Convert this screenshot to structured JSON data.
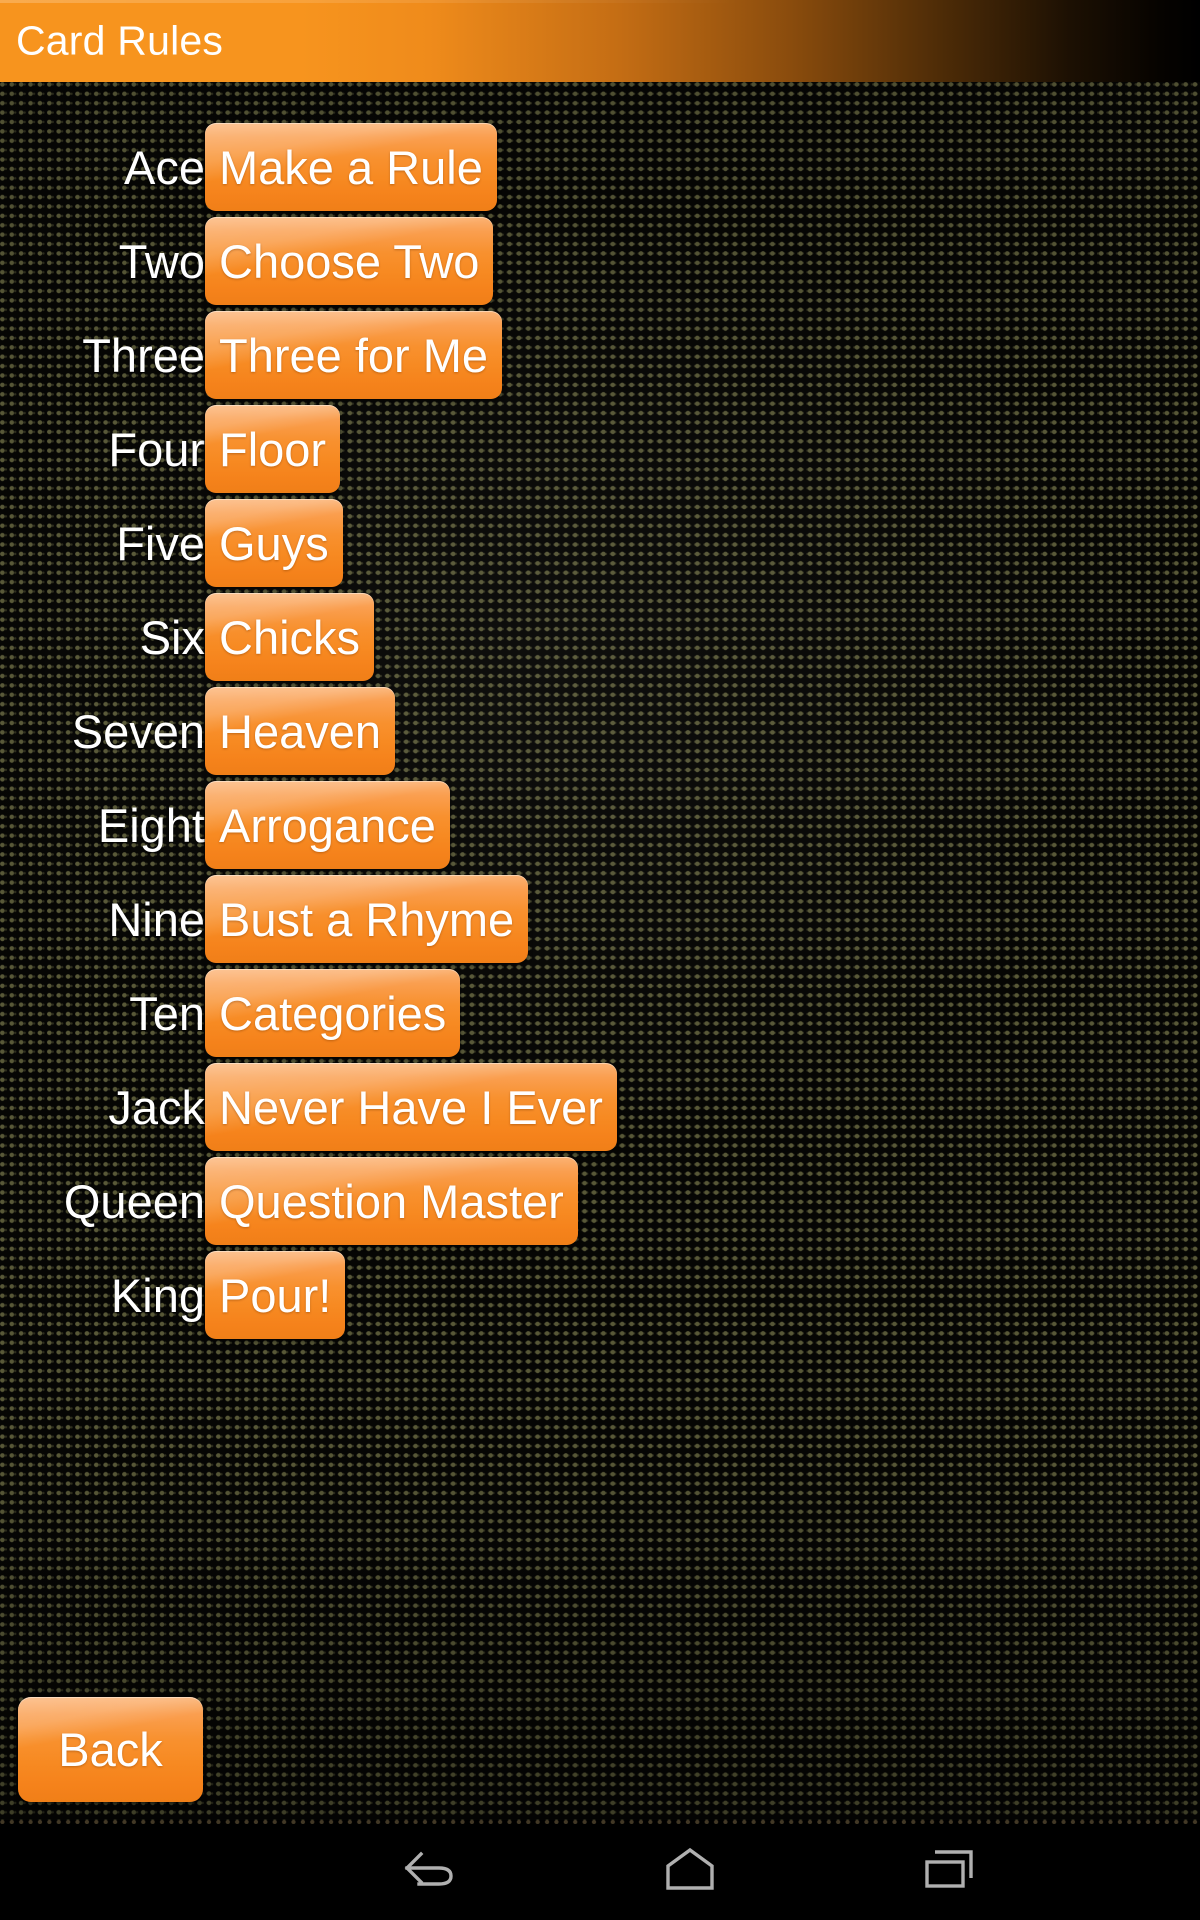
{
  "app": {
    "title": "Card Rules"
  },
  "rules": {
    "rows": [
      {
        "card": "Ace",
        "rule": "Make a Rule"
      },
      {
        "card": "Two",
        "rule": "Choose Two"
      },
      {
        "card": "Three",
        "rule": "Three for Me"
      },
      {
        "card": "Four",
        "rule": "Floor"
      },
      {
        "card": "Five",
        "rule": "Guys"
      },
      {
        "card": "Six",
        "rule": "Chicks"
      },
      {
        "card": "Seven",
        "rule": "Heaven"
      },
      {
        "card": "Eight",
        "rule": "Arrogance"
      },
      {
        "card": "Nine",
        "rule": "Bust a Rhyme"
      },
      {
        "card": "Ten",
        "rule": "Categories"
      },
      {
        "card": "Jack",
        "rule": "Never Have I Ever"
      },
      {
        "card": "Queen",
        "rule": "Question Master"
      },
      {
        "card": "King",
        "rule": "Pour!"
      }
    ]
  },
  "footer": {
    "back_label": "Back"
  },
  "navbar": {
    "back_icon": "back-arrow-icon",
    "home_icon": "home-pentagon-icon",
    "recents_icon": "recent-apps-icon"
  },
  "colors": {
    "accent_orange": "#f5821b",
    "accent_orange_light": "#fbb273",
    "title_text": "#ffffff",
    "label_text": "#ffffff",
    "background_dark": "#060604",
    "nav_icon": "#b0b0b0"
  }
}
